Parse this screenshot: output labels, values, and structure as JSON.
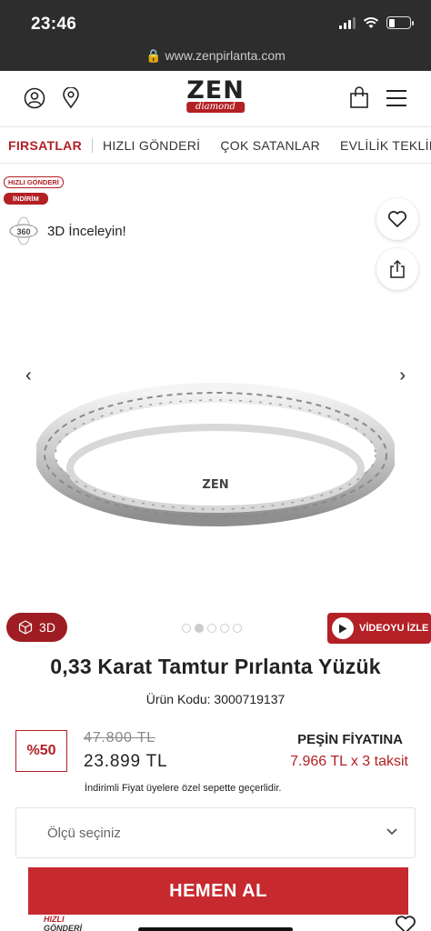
{
  "status_bar": {
    "time": "23:46"
  },
  "browser": {
    "url": "www.zenpirlanta.com"
  },
  "header": {
    "logo_text": "ZEN",
    "logo_sub": "diamond",
    "icons": [
      "user-icon",
      "location-pin-icon",
      "shopping-bag-icon",
      "hamburger-menu-icon"
    ]
  },
  "nav": {
    "items": [
      "FIRSATLAR",
      "HIZLI GÖNDERİ",
      "ÇOK SATANLAR",
      "EVLİLİK TEKLİFİ"
    ]
  },
  "gallery": {
    "badge_fast": "HIZLI GÖNDERİ",
    "badge_discount": "İNDİRİM",
    "view_360_label": "3D İnceleyin!",
    "view_360_badge": "360",
    "ring_engraving": "ZEN",
    "btn_3d": "3D",
    "video_btn": "VİDEOYU İZLE",
    "dots_count": 5,
    "active_dot": 2
  },
  "product": {
    "title": "0,33 Karat Tamtur Pırlanta Yüzük",
    "code_label": "Ürün Kodu: 3000719137",
    "discount": "%50",
    "old_price": "47.800 TL",
    "new_price": "23.899 TL",
    "cash_label": "PEŞİN FİYATINA",
    "installment": "7.966 TL x 3 taksit",
    "note": "İndirimli Fiyat üyelere özel sepette geçerlidir.",
    "size_placeholder": "Ölçü seçiniz",
    "buy_button": "HEMEN AL"
  },
  "bottom": {
    "fast_logo_line1": "HIZLI",
    "fast_logo_line2": "GÖNDERİ"
  },
  "colors": {
    "brand_red": "#b32025",
    "status_bar": "#2d2d2d"
  }
}
